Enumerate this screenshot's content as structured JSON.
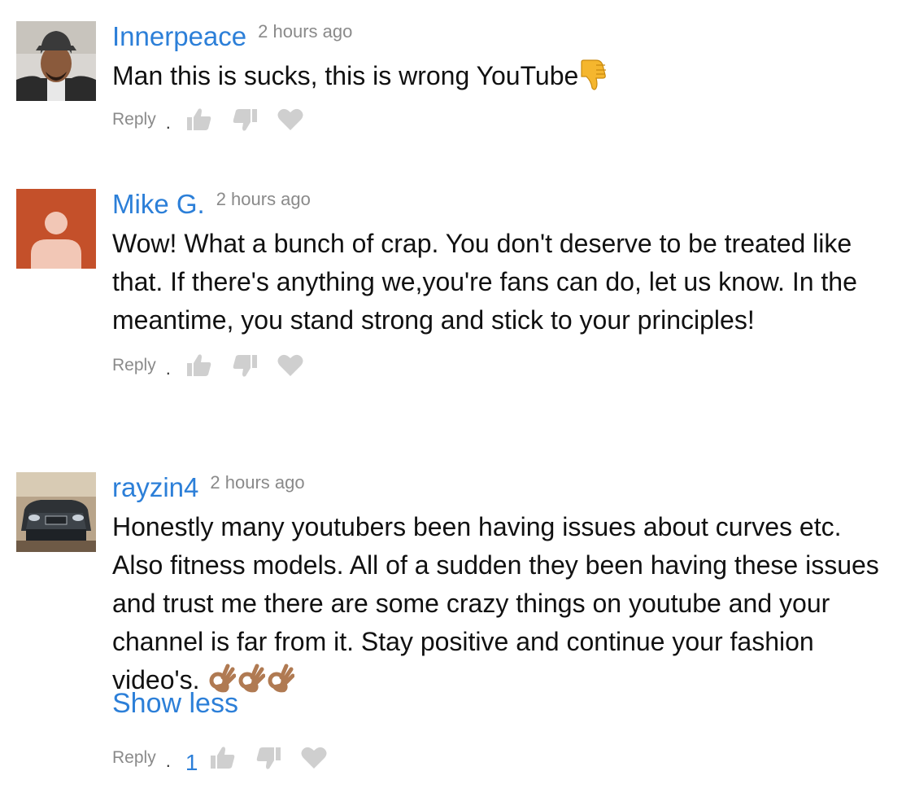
{
  "comments": [
    {
      "author": "Innerpeace",
      "time": "2 hours ago",
      "text": "Man this is sucks, this is wrong YouTube",
      "reply_label": "Reply",
      "dot": ".",
      "like_count": "",
      "avatar": "man-with-cap-photo",
      "emojis": [
        "thumbs-down-emoji"
      ]
    },
    {
      "author": "Mike G.",
      "time": "2 hours ago",
      "text": "Wow! What a bunch of crap. You don't deserve to be treated like that. If there's anything we,you're fans can do, let us know. In the meantime, you stand strong and stick to your principles!",
      "reply_label": "Reply",
      "dot": ".",
      "like_count": "",
      "avatar": "default-user-avatar",
      "emojis": []
    },
    {
      "author": "rayzin4",
      "time": "2 hours ago",
      "text": "Honestly many youtubers been having issues about curves etc. Also fitness models. All of a sudden they been having these issues and trust me there are some crazy things on youtube and your channel is far from it. Stay positive and continue your fashion video's.",
      "show_less": "Show less",
      "reply_label": "Reply",
      "dot": ".",
      "like_count": "1",
      "avatar": "car-photo",
      "emojis": [
        "ok-hand-emoji",
        "ok-hand-emoji",
        "ok-hand-emoji"
      ]
    }
  ],
  "colors": {
    "author": "#2c7fd8",
    "meta": "#8a8a8a",
    "icon": "#cfcfcf",
    "default_avatar_bg": "#c4502a",
    "default_avatar_fg": "#f2c7b6"
  },
  "icons": [
    "like-icon",
    "dislike-icon",
    "heart-icon"
  ]
}
